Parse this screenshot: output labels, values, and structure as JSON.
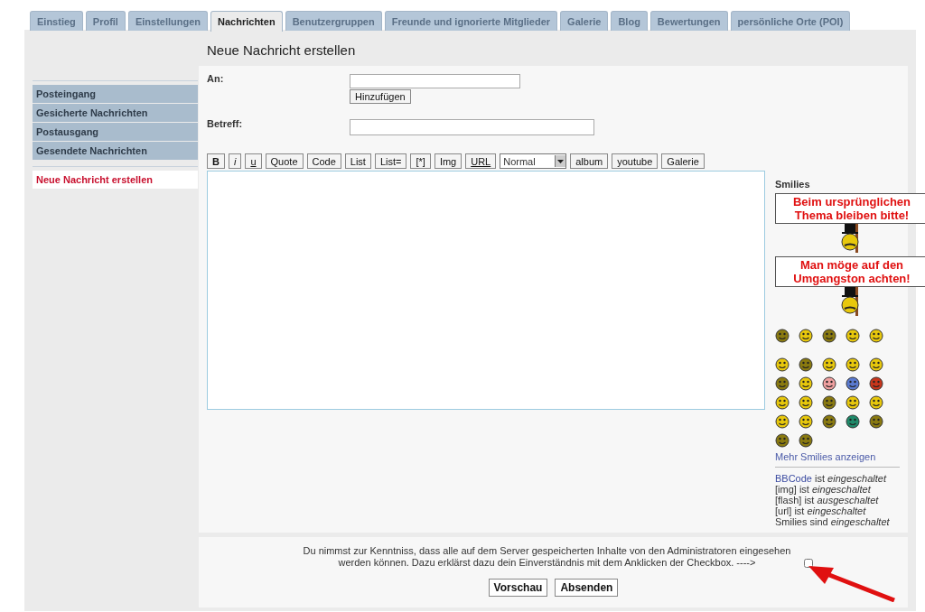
{
  "tabs": [
    {
      "label": "Einstieg",
      "selected": false
    },
    {
      "label": "Profil",
      "selected": false
    },
    {
      "label": "Einstellungen",
      "selected": false
    },
    {
      "label": "Nachrichten",
      "selected": true
    },
    {
      "label": "Benutzergruppen",
      "selected": false
    },
    {
      "label": "Freunde und ignorierte Mitglieder",
      "selected": false
    },
    {
      "label": "Galerie",
      "selected": false
    },
    {
      "label": "Blog",
      "selected": false
    },
    {
      "label": "Bewertungen",
      "selected": false
    },
    {
      "label": "persönliche Orte (POI)",
      "selected": false
    }
  ],
  "page_title": "Neue Nachricht erstellen",
  "sidebar": {
    "folders": [
      {
        "label": "Posteingang"
      },
      {
        "label": "Gesicherte Nachrichten"
      },
      {
        "label": "Postausgang"
      },
      {
        "label": "Gesendete Nachrichten"
      }
    ],
    "actions": [
      {
        "label": "Neue Nachricht erstellen",
        "selected": true
      }
    ]
  },
  "form": {
    "to_label": "An:",
    "add_button": "Hinzufügen",
    "subject_label": "Betreff:"
  },
  "toolbar": [
    {
      "kind": "bold",
      "label": "B"
    },
    {
      "kind": "italic",
      "label": "i"
    },
    {
      "kind": "underline",
      "label": "u"
    },
    {
      "kind": "button",
      "label": "Quote"
    },
    {
      "kind": "button",
      "label": "Code"
    },
    {
      "kind": "button",
      "label": "List"
    },
    {
      "kind": "button",
      "label": "List="
    },
    {
      "kind": "button",
      "label": "[*]"
    },
    {
      "kind": "button",
      "label": "Img"
    },
    {
      "kind": "underline",
      "label": "URL"
    },
    {
      "kind": "select",
      "label": "Normal"
    },
    {
      "kind": "button",
      "label": "album"
    },
    {
      "kind": "button",
      "label": "youtube"
    },
    {
      "kind": "button",
      "label": "Galerie"
    }
  ],
  "smilies": {
    "title": "Smilies",
    "signs": [
      {
        "text": "Beim ursprünglichen Thema bleiben bitte!"
      },
      {
        "text": "Man möge auf den Umgangston achten!"
      }
    ],
    "more_link": "Mehr Smilies anzeigen",
    "status": [
      {
        "link": "BBCode",
        "text": "ist *eingeschaltet*"
      },
      {
        "text": "[img] ist *eingeschaltet*"
      },
      {
        "text": "[flash] ist *ausgeschaltet*"
      },
      {
        "text": "[url] ist *eingeschaltet*"
      },
      {
        "text": "Smilies sind *eingeschaltet*"
      }
    ]
  },
  "footer": {
    "notice": "Du nimmst zur Kenntniss, dass alle auf dem Server gespeicherten Inhalte von den Administratoren eingesehen werden können. Dazu erklärst dazu dein Einverständnis mit dem Anklicken der Checkbox. ---->",
    "consent_checked": false,
    "buttons": [
      {
        "label": "Vorschau"
      },
      {
        "label": "Absenden"
      }
    ]
  }
}
